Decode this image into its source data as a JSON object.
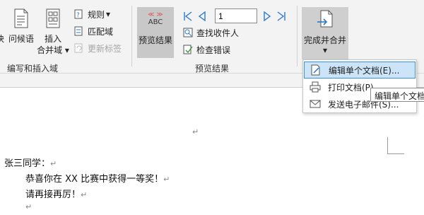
{
  "ribbon": {
    "write_insert": {
      "partial_button": "块",
      "greeting_button": "问候语",
      "insert_field_line1": "插入",
      "insert_field_line2": "合并域",
      "dropdown_arrow": "▾",
      "rules_label": "规则",
      "match_fields_label": "匹配域",
      "update_labels_label": "更新标签",
      "group_label": "编写和插入域"
    },
    "preview": {
      "preview_icon_text": "ABC",
      "preview_icon_arrows": "≪ ≫",
      "preview_results_label": "预览结果",
      "record_value": "1",
      "find_recipient_label": "查找收件人",
      "check_errors_label": "检查错误",
      "group_label": "预览结果"
    },
    "finish": {
      "finish_merge_label": "完成并合并",
      "dropdown_arrow": "▾"
    }
  },
  "dropdown_menu": {
    "items": [
      {
        "label": "编辑单个文档(E)...",
        "icon": "edit-document-icon",
        "active": true
      },
      {
        "label": "打印文档(P)...",
        "icon": "printer-icon",
        "active": false
      },
      {
        "label": "发送电子邮件(S)...",
        "icon": "email-icon",
        "active": false
      }
    ]
  },
  "tooltip": {
    "text": "编辑单个文档"
  },
  "document": {
    "lines": [
      "张三同学：",
      "恭喜你在 XX 比赛中获得一等奖！",
      "请再接再厉！"
    ],
    "paragraph_mark": "↵"
  },
  "colors": {
    "ribbon_bg": "#f3f3f3",
    "selected_btn_bg": "#c8c8c8",
    "nav_blue": "#2b79d0",
    "menu_highlight": "#cce4f7",
    "menu_highlight_border": "#3d8fd6",
    "preview_red": "#d9534f"
  }
}
